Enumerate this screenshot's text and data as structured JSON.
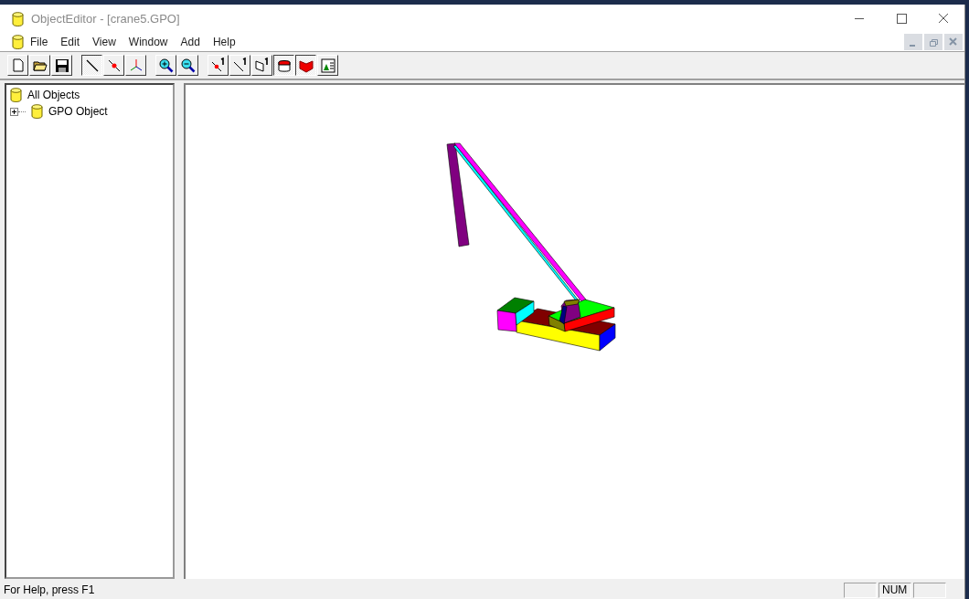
{
  "window": {
    "title": "ObjectEditor - [crane5.GPO]"
  },
  "menu": [
    "File",
    "Edit",
    "View",
    "Window",
    "Add",
    "Help"
  ],
  "toolbar": [
    {
      "kind": "new",
      "pressed": false
    },
    {
      "kind": "open",
      "pressed": false
    },
    {
      "kind": "save",
      "pressed": false
    },
    {
      "kind": "sep"
    },
    {
      "kind": "line",
      "pressed": true
    },
    {
      "kind": "point",
      "pressed": false
    },
    {
      "kind": "axes",
      "pressed": false
    },
    {
      "kind": "sep"
    },
    {
      "kind": "zoom-in",
      "pressed": false
    },
    {
      "kind": "zoom-out",
      "pressed": false
    },
    {
      "kind": "sep"
    },
    {
      "kind": "point-one",
      "pressed": false
    },
    {
      "kind": "line-one",
      "pressed": false
    },
    {
      "kind": "face-one",
      "pressed": false
    },
    {
      "kind": "solid",
      "pressed": true
    },
    {
      "kind": "shaded",
      "pressed": true
    },
    {
      "kind": "image",
      "pressed": false
    }
  ],
  "tree": [
    {
      "label": "All Objects",
      "children": [
        {
          "label": "GPO Object",
          "expanded": false
        }
      ]
    }
  ],
  "status_bar": {
    "help_text": "For Help, press F1",
    "indicators": [
      "NUM"
    ]
  }
}
